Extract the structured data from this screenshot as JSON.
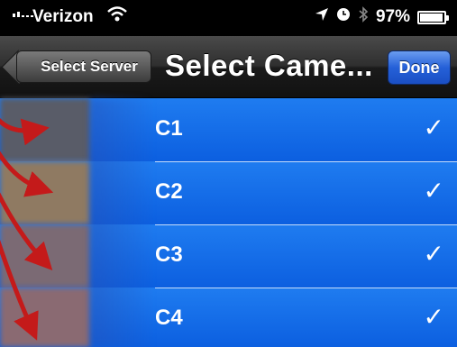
{
  "status_bar": {
    "carrier": "Verizon",
    "battery_text": "97%",
    "battery_level": 0.97
  },
  "nav": {
    "back_label": "Select Server",
    "title": "Select Came...",
    "done_label": "Done"
  },
  "cameras": [
    {
      "label": "C1",
      "check": "✓"
    },
    {
      "label": "C2",
      "check": "✓"
    },
    {
      "label": "C3",
      "check": "✓"
    },
    {
      "label": "C4",
      "check": "✓"
    }
  ],
  "colors": {
    "selected_row": "#1f7cf0",
    "done_button": "#2560d8",
    "arrow": "#c41a1a"
  }
}
